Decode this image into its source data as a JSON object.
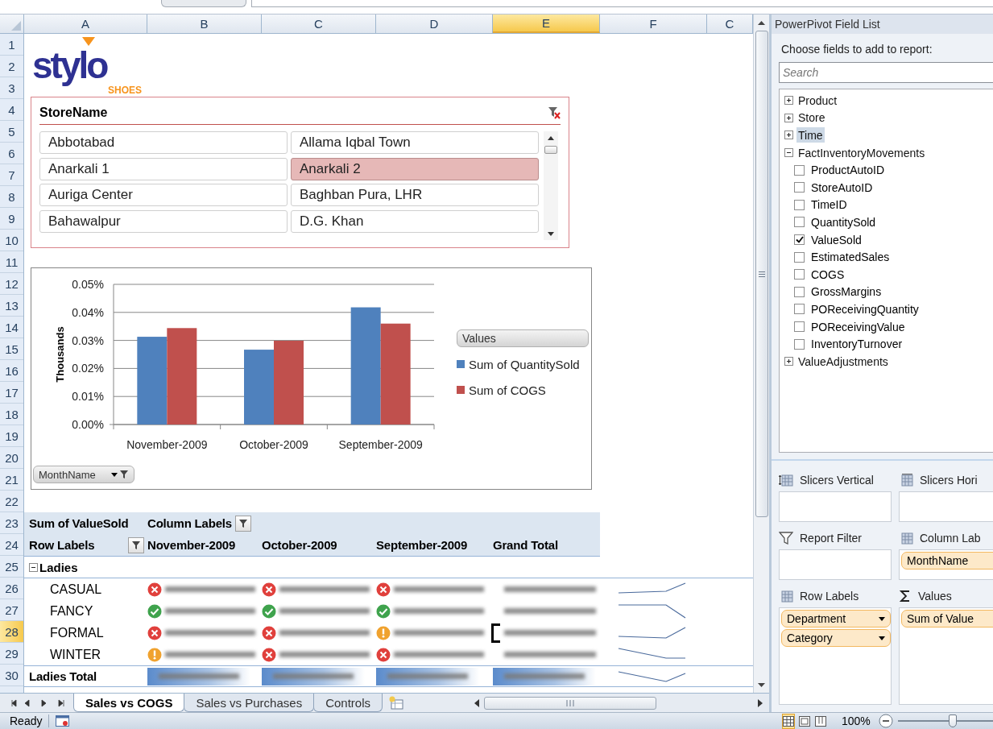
{
  "column_headers": [
    {
      "label": "A",
      "selected": false
    },
    {
      "label": "B",
      "selected": false
    },
    {
      "label": "C",
      "selected": false
    },
    {
      "label": "D",
      "selected": false
    },
    {
      "label": "E",
      "selected": true
    },
    {
      "label": "F",
      "selected": false
    },
    {
      "label": "C",
      "selected": false
    }
  ],
  "row_headers": [
    {
      "label": "1",
      "selected": false
    },
    {
      "label": "2",
      "selected": false
    },
    {
      "label": "3",
      "selected": false
    },
    {
      "label": "4",
      "selected": false
    },
    {
      "label": "5",
      "selected": false
    },
    {
      "label": "6",
      "selected": false
    },
    {
      "label": "7",
      "selected": false
    },
    {
      "label": "8",
      "selected": false
    },
    {
      "label": "9",
      "selected": false
    },
    {
      "label": "10",
      "selected": false
    },
    {
      "label": "11",
      "selected": false
    },
    {
      "label": "12",
      "selected": false
    },
    {
      "label": "13",
      "selected": false
    },
    {
      "label": "14",
      "selected": false
    },
    {
      "label": "15",
      "selected": false
    },
    {
      "label": "16",
      "selected": false
    },
    {
      "label": "17",
      "selected": false
    },
    {
      "label": "18",
      "selected": false
    },
    {
      "label": "19",
      "selected": false
    },
    {
      "label": "20",
      "selected": false
    },
    {
      "label": "21",
      "selected": false
    },
    {
      "label": "22",
      "selected": false
    },
    {
      "label": "23",
      "selected": false
    },
    {
      "label": "24",
      "selected": false
    },
    {
      "label": "25",
      "selected": false
    },
    {
      "label": "26",
      "selected": false
    },
    {
      "label": "27",
      "selected": false
    },
    {
      "label": "28",
      "selected": true
    },
    {
      "label": "29",
      "selected": false
    },
    {
      "label": "30",
      "selected": false
    }
  ],
  "logo": {
    "wordmark": "stylo",
    "tagline": "SHOES"
  },
  "slicer": {
    "title": "StoreName",
    "items": [
      {
        "label": "Abbotabad",
        "selected": false
      },
      {
        "label": "Allama Iqbal Town",
        "selected": false
      },
      {
        "label": "Anarkali 1",
        "selected": false
      },
      {
        "label": "Anarkali 2",
        "selected": true
      },
      {
        "label": "Auriga Center",
        "selected": false
      },
      {
        "label": "Baghban Pura, LHR",
        "selected": false
      },
      {
        "label": "Bahawalpur",
        "selected": false
      },
      {
        "label": "D.G. Khan",
        "selected": false
      }
    ]
  },
  "chart": {
    "legend_title": "Values",
    "field_button": "MonthName",
    "chart_data": {
      "type": "bar",
      "ylabel": "Thousands",
      "categories": [
        "November-2009",
        "October-2009",
        "September-2009"
      ],
      "series": [
        {
          "name": "Sum of QuantitySold",
          "color": "#4f81bd",
          "values": [
            0.0313,
            0.0267,
            0.0418
          ]
        },
        {
          "name": "Sum of COGS",
          "color": "#c0504d",
          "values": [
            0.0344,
            0.0299,
            0.036
          ]
        }
      ],
      "grid": true,
      "ylim": [
        0,
        0.05
      ],
      "yticks": [
        {
          "value": 0,
          "label": "0.00%"
        },
        {
          "value": 0.01,
          "label": "0.01%"
        },
        {
          "value": 0.02,
          "label": "0.02%"
        },
        {
          "value": 0.03,
          "label": "0.03%"
        },
        {
          "value": 0.04,
          "label": "0.04%"
        },
        {
          "value": 0.05,
          "label": "0.05%"
        }
      ]
    }
  },
  "pivot": {
    "value_field": "Sum of ValueSold",
    "column_labels": "Column Labels",
    "row_labels": "Row Labels",
    "columns": [
      "November-2009",
      "October-2009",
      "September-2009",
      "Grand Total"
    ],
    "groups": [
      {
        "label": "Ladies",
        "expanded": true,
        "total_label": "Ladies Total",
        "rows": [
          {
            "label": "CASUAL",
            "cells": [
              {
                "kind": "bad"
              },
              {
                "kind": "bad"
              },
              {
                "kind": "bad"
              }
            ]
          },
          {
            "label": "FANCY",
            "cells": [
              {
                "kind": "good"
              },
              {
                "kind": "good"
              },
              {
                "kind": "good"
              }
            ]
          },
          {
            "label": "FORMAL",
            "cells": [
              {
                "kind": "bad"
              },
              {
                "kind": "bad"
              },
              {
                "kind": "warning"
              }
            ]
          },
          {
            "label": "WINTER",
            "cells": [
              {
                "kind": "warning"
              },
              {
                "kind": "bad"
              },
              {
                "kind": "bad"
              }
            ]
          }
        ]
      }
    ]
  },
  "sheet_tabs": [
    {
      "label": "Sales vs COGS",
      "selected": true
    },
    {
      "label": "Sales vs Purchases",
      "selected": false
    },
    {
      "label": "Controls",
      "selected": false
    }
  ],
  "field_list": {
    "title": "PowerPivot Field List",
    "prompt": "Choose fields to add to report:",
    "search_placeholder": "Search",
    "tables": [
      {
        "label": "Product",
        "expanded": false,
        "selected": false
      },
      {
        "label": "Store",
        "expanded": false,
        "selected": false
      },
      {
        "label": "Time",
        "expanded": false,
        "selected": true
      },
      {
        "label": "FactInventoryMovements",
        "expanded": true,
        "selected": false,
        "children": [
          {
            "label": "ProductAutoID",
            "checked": false
          },
          {
            "label": "StoreAutoID",
            "checked": false
          },
          {
            "label": "TimeID",
            "checked": false
          },
          {
            "label": "QuantitySold",
            "checked": false
          },
          {
            "label": "ValueSold",
            "checked": true
          },
          {
            "label": "EstimatedSales",
            "checked": false
          },
          {
            "label": "COGS",
            "checked": false
          },
          {
            "label": "GrossMargins",
            "checked": false
          },
          {
            "label": "POReceivingQuantity",
            "checked": false
          },
          {
            "label": "POReceivingValue",
            "checked": false
          },
          {
            "label": "InventoryTurnover",
            "checked": false
          }
        ]
      },
      {
        "label": "ValueAdjustments",
        "expanded": false,
        "selected": false
      }
    ],
    "areas": [
      {
        "kind": "slicers-vertical",
        "label": "Slicers Vertical"
      },
      {
        "kind": "slicers-horizontal",
        "label": "Slicers Hori"
      },
      {
        "kind": "filter",
        "label": "Report Filter"
      },
      {
        "kind": "columns",
        "label": "Column Lab",
        "fields": [
          "MonthName"
        ]
      },
      {
        "kind": "rows",
        "label": "Row Labels",
        "fields": [
          "Department",
          "Category"
        ]
      },
      {
        "kind": "values",
        "label": "Values",
        "fields": [
          "Sum of Value"
        ]
      }
    ]
  },
  "status_bar": {
    "text": "Ready",
    "views": [
      {
        "kind": "normal",
        "selected": true
      },
      {
        "kind": "page-layout",
        "selected": false
      },
      {
        "kind": "page-break",
        "selected": false
      }
    ],
    "zoom": "100%",
    "zoom_slider": {
      "level": 0.56
    }
  }
}
